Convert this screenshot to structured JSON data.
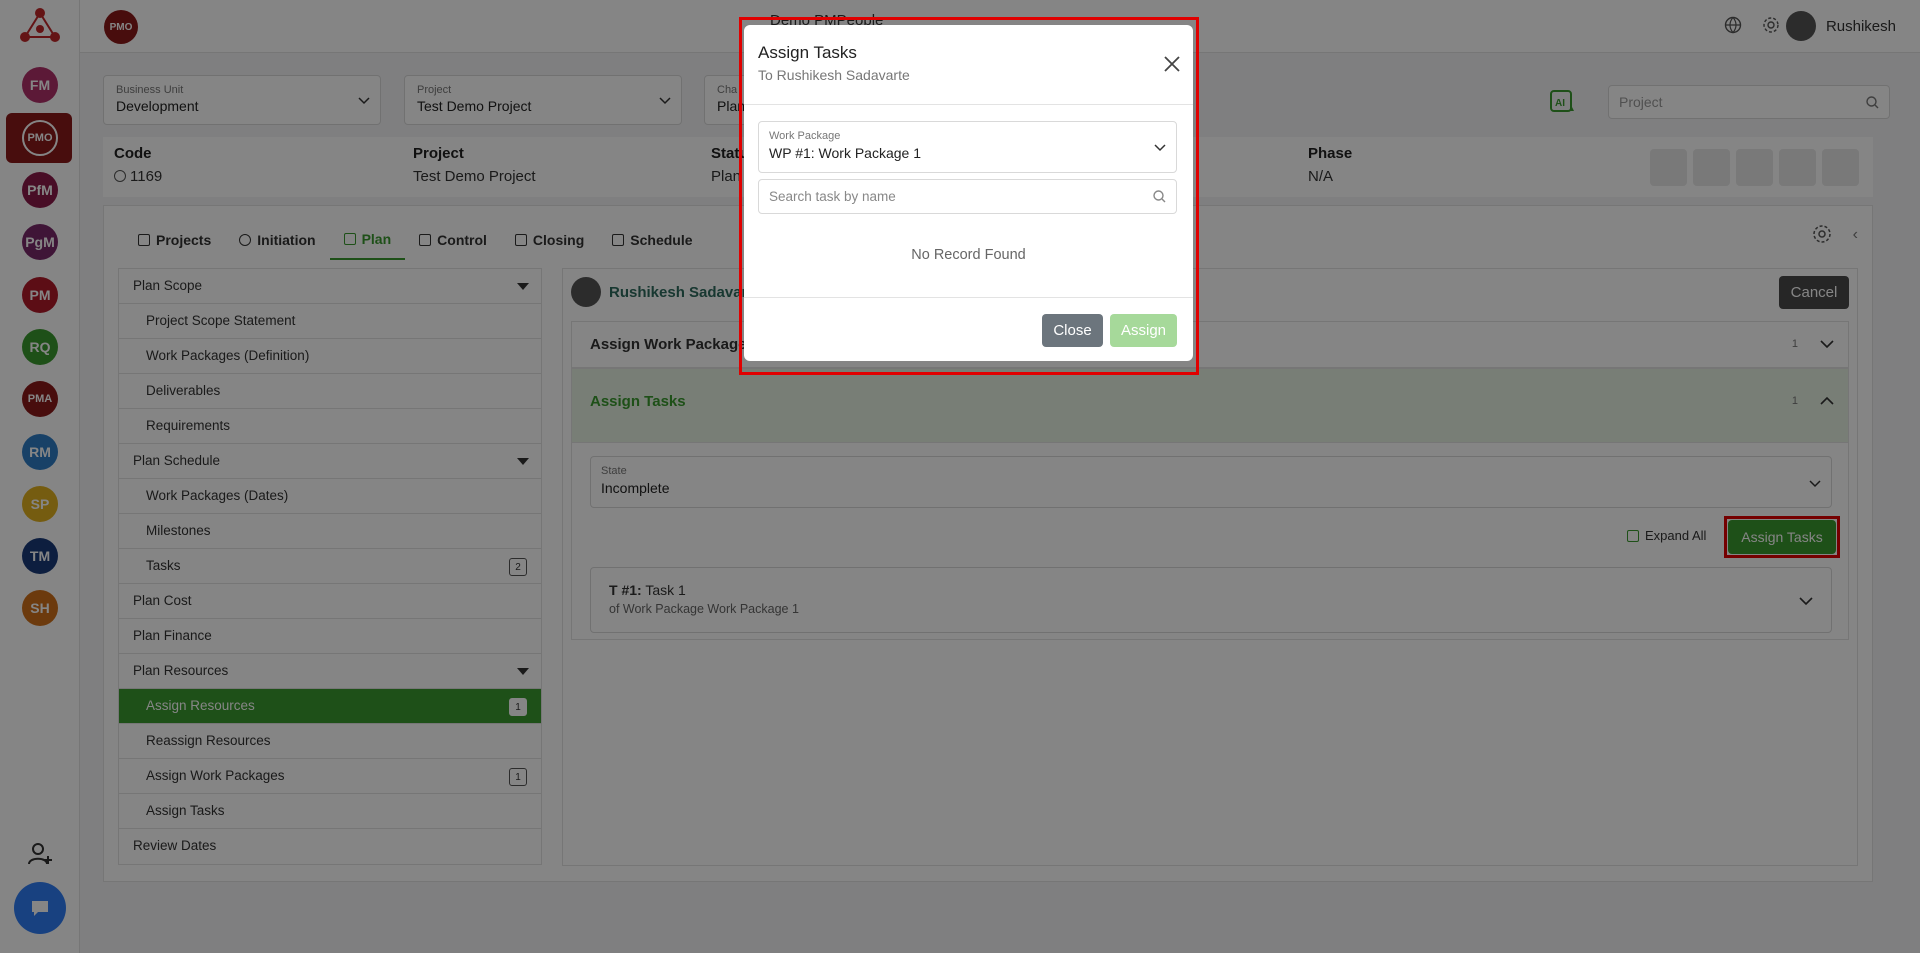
{
  "rail": {
    "items": [
      {
        "label": "FM",
        "color": "#b0306a"
      },
      {
        "label": "PMO",
        "color": "#8b1a1a"
      },
      {
        "label": "PfM",
        "color": "#8b1a4a"
      },
      {
        "label": "PgM",
        "color": "#7a2a6a"
      },
      {
        "label": "PM",
        "color": "#b01a2a"
      },
      {
        "label": "RQ",
        "color": "#3a9a2e"
      },
      {
        "label": "PMA",
        "color": "#8b1a1a"
      },
      {
        "label": "RM",
        "color": "#2f7dc6"
      },
      {
        "label": "SP",
        "color": "#e0b020"
      },
      {
        "label": "TM",
        "color": "#1a3a7a"
      },
      {
        "label": "SH",
        "color": "#d0701a"
      }
    ]
  },
  "topbar": {
    "pmo_badge": "PMO",
    "center_title": "Demo PMPeople",
    "user_name": "Rushikesh"
  },
  "filters": {
    "business_unit": {
      "label": "Business Unit",
      "value": "Development"
    },
    "project": {
      "label": "Project",
      "value": "Test Demo Project"
    },
    "change": {
      "label": "Cha",
      "value": "Plan"
    },
    "search_placeholder": "Project"
  },
  "info": {
    "code_label": "Code",
    "code_value": "1169",
    "project_label": "Project",
    "project_value": "Test Demo Project",
    "status_label": "Statu",
    "status_value": "Plan",
    "phase_label": "Phase",
    "phase_value": "N/A"
  },
  "tabs": [
    "Projects",
    "Initiation",
    "Plan",
    "Control",
    "Closing",
    "Schedule"
  ],
  "leftnav": [
    {
      "label": "Plan Scope",
      "type": "group"
    },
    {
      "label": "Project Scope Statement",
      "type": "sub"
    },
    {
      "label": "Work Packages (Definition)",
      "type": "sub"
    },
    {
      "label": "Deliverables",
      "type": "sub"
    },
    {
      "label": "Requirements",
      "type": "sub"
    },
    {
      "label": "Plan Schedule",
      "type": "group"
    },
    {
      "label": "Work Packages (Dates)",
      "type": "sub"
    },
    {
      "label": "Milestones",
      "type": "sub"
    },
    {
      "label": "Tasks",
      "type": "sub",
      "badge": "2"
    },
    {
      "label": "Plan Cost",
      "type": "plain"
    },
    {
      "label": "Plan Finance",
      "type": "plain"
    },
    {
      "label": "Plan Resources",
      "type": "group"
    },
    {
      "label": "Assign Resources",
      "type": "sub",
      "badge": "1",
      "active": true
    },
    {
      "label": "Reassign Resources",
      "type": "sub"
    },
    {
      "label": "Assign Work Packages",
      "type": "sub",
      "badge": "1"
    },
    {
      "label": "Assign Tasks",
      "type": "sub"
    },
    {
      "label": "Review Dates",
      "type": "plain"
    }
  ],
  "panel": {
    "user": "Rushikesh Sadavar",
    "cancel": "Cancel",
    "acc_wp": {
      "title": "Assign Work Packages",
      "count": "1"
    },
    "acc_tasks": {
      "title": "Assign Tasks",
      "count": "1"
    },
    "state": {
      "label": "State",
      "value": "Incomplete"
    },
    "expand_all": "Expand All",
    "assign_tasks_btn": "Assign Tasks",
    "task": {
      "code": "T #1:",
      "name": "Task 1",
      "sub": "of Work Package Work Package 1"
    }
  },
  "modal": {
    "title": "Assign Tasks",
    "subtitle": "To Rushikesh Sadavarte",
    "wp_label": "Work Package",
    "wp_value": "WP #1: Work Package 1",
    "search_placeholder": "Search task by name",
    "empty": "No Record Found",
    "close": "Close",
    "assign": "Assign"
  }
}
